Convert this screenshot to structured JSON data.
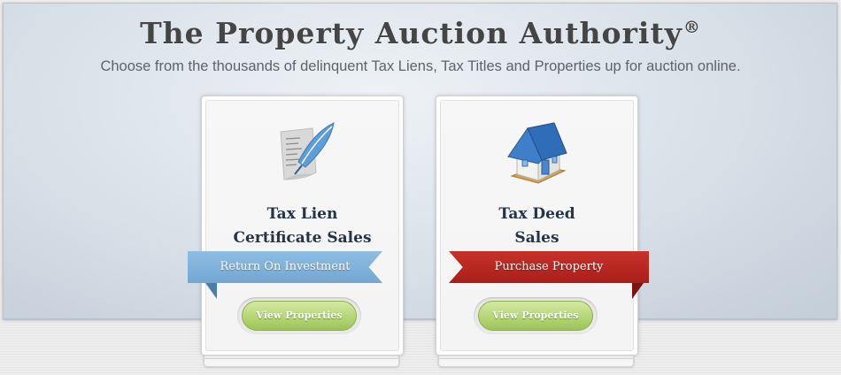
{
  "header": {
    "title": "The Property Auction Authority",
    "title_mark": "®",
    "subtitle": "Choose from the thousands of delinquent Tax Liens, Tax Titles and Properties up for auction online."
  },
  "cards": [
    {
      "icon": "quill-document-icon",
      "title_line1": "Tax Lien",
      "title_line2": "Certificate Sales",
      "ribbon_label": "Return On Investment",
      "ribbon_color": "#7eaed6",
      "button_label": "View Properties"
    },
    {
      "icon": "house-icon",
      "title_line1": "Tax Deed",
      "title_line2": "Sales",
      "ribbon_label": "Purchase Property",
      "ribbon_color": "#b5251e",
      "button_label": "View Properties"
    }
  ],
  "colors": {
    "button_green": "#b8d97a",
    "title_text": "#454545",
    "card_title": "#24344a"
  }
}
